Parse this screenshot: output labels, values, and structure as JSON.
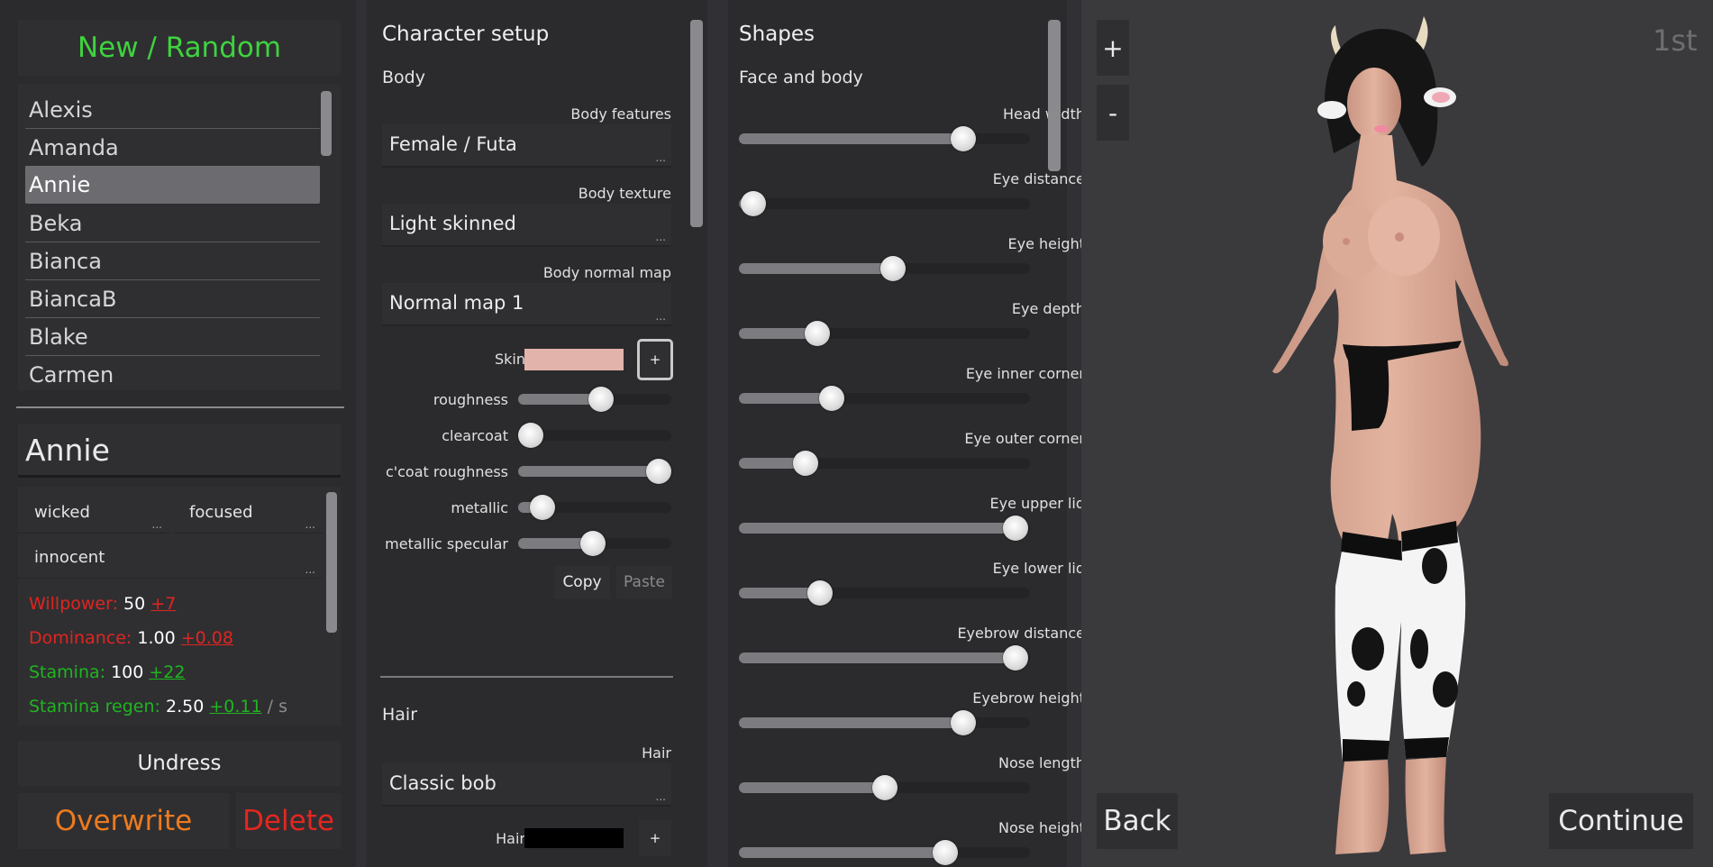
{
  "left_panel": {
    "new_random": "New / Random",
    "characters": [
      "Alexis",
      "Amanda",
      "Annie",
      "Beka",
      "Bianca",
      "BiancaB",
      "Blake",
      "Carmen"
    ],
    "selected_name": "Annie",
    "traits": [
      "wicked",
      "focused",
      "innocent"
    ],
    "trait_more": "...",
    "stats": [
      {
        "label": "Willpower:",
        "value": "50",
        "delta": "+7",
        "color": "red"
      },
      {
        "label": "Dominance:",
        "value": "1.00",
        "delta": "+0.08",
        "color": "red"
      },
      {
        "label": "Stamina:",
        "value": "100",
        "delta": "+22",
        "color": "green"
      },
      {
        "label": "Stamina regen:",
        "value": "2.50",
        "delta": "+0.11",
        "unit": "/ s",
        "color": "green"
      }
    ],
    "undress": "Undress",
    "overwrite": "Overwrite",
    "delete": "Delete"
  },
  "character_setup": {
    "title": "Character setup",
    "body_title": "Body",
    "body_features_label": "Body features",
    "body_features_value": "Female / Futa",
    "body_texture_label": "Body texture",
    "body_texture_value": "Light skinned",
    "body_normal_label": "Body normal map",
    "body_normal_value": "Normal map 1",
    "skin_label": "Skin",
    "skin_color": "#e2b3ab",
    "plus": "+",
    "sliders": [
      {
        "label": "roughness",
        "value": 0.54
      },
      {
        "label": "clearcoat",
        "value": 0.08
      },
      {
        "label": "c'coat roughness",
        "value": 0.92
      },
      {
        "label": "metallic",
        "value": 0.16
      },
      {
        "label": "metallic specular",
        "value": 0.49
      }
    ],
    "copy": "Copy",
    "paste": "Paste",
    "hair_title": "Hair",
    "hair_label": "Hair",
    "hair_value": "Classic bob",
    "hair_color_label": "Hair",
    "hair_color": "#000000",
    "dots": "..."
  },
  "shapes": {
    "title": "Shapes",
    "subtitle": "Face and body",
    "sliders": [
      {
        "label": "Head width",
        "value": 0.77
      },
      {
        "label": "Eye distance",
        "value": 0.05
      },
      {
        "label": "Eye height",
        "value": 0.53
      },
      {
        "label": "Eye depth",
        "value": 0.27
      },
      {
        "label": "Eye inner corner",
        "value": 0.32
      },
      {
        "label": "Eye outer corner",
        "value": 0.23
      },
      {
        "label": "Eye upper lid",
        "value": 0.95
      },
      {
        "label": "Eye lower lid",
        "value": 0.28
      },
      {
        "label": "Eyebrow distance",
        "value": 0.95
      },
      {
        "label": "Eyebrow height",
        "value": 0.77
      },
      {
        "label": "Nose length",
        "value": 0.5
      },
      {
        "label": "Nose height",
        "value": 0.71
      }
    ]
  },
  "viewport": {
    "zoom_in": "+",
    "zoom_out": "-",
    "view_mode": "1st",
    "back": "Back",
    "continue": "Continue"
  }
}
